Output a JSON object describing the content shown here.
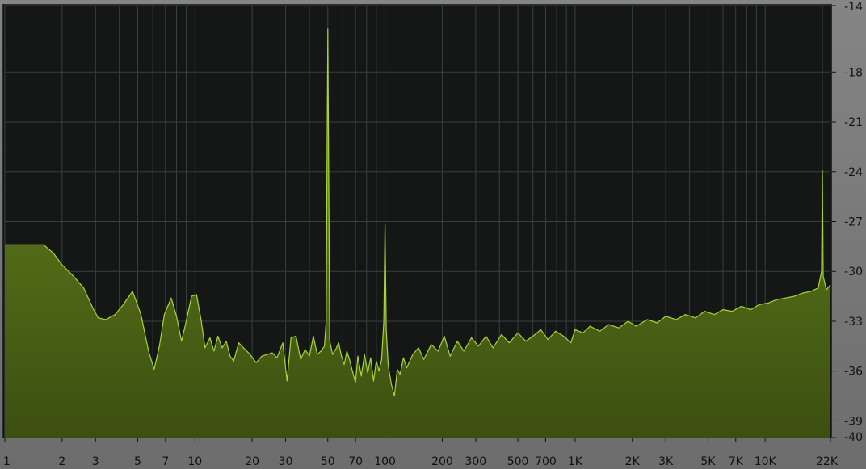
{
  "chart_data": {
    "type": "area",
    "title": "",
    "xlabel": "",
    "ylabel": "",
    "x_scale": "log",
    "xlim": [
      1,
      22050
    ],
    "ylim": [
      -40,
      -14
    ],
    "grid": true,
    "legend": "none",
    "colors": {
      "fill_top": "#6b8a1e",
      "fill_bottom": "#3c4f11",
      "line": "#a8d435",
      "background": "#151717",
      "grid": "#3a3f3f",
      "panel": "#7a7a7a",
      "label": "#111111"
    },
    "x_ticks": [
      {
        "value": 1,
        "label": "1"
      },
      {
        "value": 2,
        "label": "2"
      },
      {
        "value": 3,
        "label": "3"
      },
      {
        "value": 5,
        "label": "5"
      },
      {
        "value": 7,
        "label": "7"
      },
      {
        "value": 10,
        "label": "10"
      },
      {
        "value": 20,
        "label": "20"
      },
      {
        "value": 30,
        "label": "30"
      },
      {
        "value": 50,
        "label": "50"
      },
      {
        "value": 70,
        "label": "70"
      },
      {
        "value": 100,
        "label": "100"
      },
      {
        "value": 200,
        "label": "200"
      },
      {
        "value": 300,
        "label": "300"
      },
      {
        "value": 500,
        "label": "500"
      },
      {
        "value": 700,
        "label": "700"
      },
      {
        "value": 1000,
        "label": "1K"
      },
      {
        "value": 2000,
        "label": "2K"
      },
      {
        "value": 3000,
        "label": "3K"
      },
      {
        "value": 5000,
        "label": "5K"
      },
      {
        "value": 7000,
        "label": "7K"
      },
      {
        "value": 10000,
        "label": "10K"
      },
      {
        "value": 22050,
        "label": "22K"
      }
    ],
    "y_ticks": [
      {
        "value": -14,
        "label": "-14"
      },
      {
        "value": -18,
        "label": "-18"
      },
      {
        "value": -21,
        "label": "-21"
      },
      {
        "value": -24,
        "label": "-24"
      },
      {
        "value": -27,
        "label": "-27"
      },
      {
        "value": -30,
        "label": "-30"
      },
      {
        "value": -33,
        "label": "-33"
      },
      {
        "value": -36,
        "label": "-36"
      },
      {
        "value": -39,
        "label": "-39"
      },
      {
        "value": -40,
        "label": "-40"
      }
    ],
    "series": [
      {
        "points": [
          [
            1,
            -28.4
          ],
          [
            1.6,
            -28.4
          ],
          [
            1.8,
            -28.9
          ],
          [
            2.0,
            -29.6
          ],
          [
            2.3,
            -30.3
          ],
          [
            2.6,
            -31.0
          ],
          [
            2.9,
            -32.2
          ],
          [
            3.1,
            -32.8
          ],
          [
            3.4,
            -32.9
          ],
          [
            3.8,
            -32.6
          ],
          [
            4.2,
            -32.0
          ],
          [
            4.7,
            -31.2
          ],
          [
            5.2,
            -32.6
          ],
          [
            5.7,
            -34.8
          ],
          [
            6.1,
            -35.9
          ],
          [
            6.5,
            -34.5
          ],
          [
            6.9,
            -32.6
          ],
          [
            7.5,
            -31.6
          ],
          [
            8.0,
            -32.7
          ],
          [
            8.5,
            -34.2
          ],
          [
            9.0,
            -33.0
          ],
          [
            9.6,
            -31.5
          ],
          [
            10.2,
            -31.4
          ],
          [
            10.8,
            -33.0
          ],
          [
            11.3,
            -34.6
          ],
          [
            12.0,
            -34.0
          ],
          [
            12.6,
            -34.8
          ],
          [
            13.2,
            -33.9
          ],
          [
            13.9,
            -34.6
          ],
          [
            14.6,
            -34.2
          ],
          [
            15.3,
            -35.1
          ],
          [
            16.0,
            -35.4
          ],
          [
            17.0,
            -34.3
          ],
          [
            18.0,
            -34.6
          ],
          [
            19.5,
            -35.0
          ],
          [
            21.0,
            -35.5
          ],
          [
            22.5,
            -35.1
          ],
          [
            24.0,
            -35.0
          ],
          [
            25.5,
            -34.9
          ],
          [
            27.0,
            -35.2
          ],
          [
            29.0,
            -34.3
          ],
          [
            30.5,
            -36.6
          ],
          [
            32.0,
            -34.0
          ],
          [
            34.0,
            -33.9
          ],
          [
            36.0,
            -35.3
          ],
          [
            38.0,
            -34.7
          ],
          [
            40.0,
            -35.1
          ],
          [
            42.0,
            -33.9
          ],
          [
            44.0,
            -35.0
          ],
          [
            46.0,
            -34.8
          ],
          [
            48.0,
            -34.5
          ],
          [
            49.0,
            -33.0
          ],
          [
            49.6,
            -22.5
          ],
          [
            50.0,
            -15.4
          ],
          [
            50.4,
            -22.0
          ],
          [
            51.2,
            -34.2
          ],
          [
            53.0,
            -35.0
          ],
          [
            55.0,
            -34.7
          ],
          [
            57.0,
            -34.3
          ],
          [
            59.0,
            -35.1
          ],
          [
            61.0,
            -35.6
          ],
          [
            63.0,
            -34.8
          ],
          [
            65.0,
            -35.3
          ],
          [
            67.0,
            -35.9
          ],
          [
            70.0,
            -36.7
          ],
          [
            72.0,
            -35.1
          ],
          [
            75.0,
            -36.3
          ],
          [
            78.0,
            -35.0
          ],
          [
            81.0,
            -36.1
          ],
          [
            84.0,
            -35.2
          ],
          [
            87.0,
            -36.6
          ],
          [
            90.0,
            -35.4
          ],
          [
            93.0,
            -36.0
          ],
          [
            96.0,
            -35.3
          ],
          [
            98.5,
            -33.0
          ],
          [
            100.0,
            -27.1
          ],
          [
            101.5,
            -33.5
          ],
          [
            104.0,
            -35.7
          ],
          [
            108.0,
            -36.8
          ],
          [
            112.0,
            -37.5
          ],
          [
            116.0,
            -35.9
          ],
          [
            120.0,
            -36.2
          ],
          [
            125.0,
            -35.2
          ],
          [
            130.0,
            -35.8
          ],
          [
            140.0,
            -35.0
          ],
          [
            150.0,
            -34.6
          ],
          [
            160.0,
            -35.3
          ],
          [
            175.0,
            -34.4
          ],
          [
            190.0,
            -34.8
          ],
          [
            205.0,
            -33.9
          ],
          [
            220.0,
            -35.1
          ],
          [
            240.0,
            -34.2
          ],
          [
            260.0,
            -34.8
          ],
          [
            285.0,
            -34.0
          ],
          [
            310.0,
            -34.5
          ],
          [
            340.0,
            -33.9
          ],
          [
            370.0,
            -34.6
          ],
          [
            410.0,
            -33.8
          ],
          [
            450.0,
            -34.3
          ],
          [
            500.0,
            -33.7
          ],
          [
            550.0,
            -34.2
          ],
          [
            600.0,
            -33.9
          ],
          [
            660.0,
            -33.5
          ],
          [
            720.0,
            -34.1
          ],
          [
            790.0,
            -33.6
          ],
          [
            870.0,
            -33.9
          ],
          [
            950.0,
            -34.3
          ],
          [
            1000.0,
            -33.5
          ],
          [
            1100.0,
            -33.7
          ],
          [
            1200.0,
            -33.3
          ],
          [
            1350.0,
            -33.6
          ],
          [
            1500.0,
            -33.2
          ],
          [
            1700.0,
            -33.4
          ],
          [
            1900.0,
            -33.0
          ],
          [
            2100.0,
            -33.3
          ],
          [
            2400.0,
            -32.9
          ],
          [
            2700.0,
            -33.1
          ],
          [
            3000.0,
            -32.7
          ],
          [
            3400.0,
            -32.9
          ],
          [
            3800.0,
            -32.6
          ],
          [
            4300.0,
            -32.8
          ],
          [
            4800.0,
            -32.4
          ],
          [
            5400.0,
            -32.6
          ],
          [
            6000.0,
            -32.3
          ],
          [
            6700.0,
            -32.4
          ],
          [
            7500.0,
            -32.1
          ],
          [
            8400.0,
            -32.3
          ],
          [
            9300.0,
            -32.0
          ],
          [
            10400.0,
            -31.9
          ],
          [
            11500.0,
            -31.7
          ],
          [
            12800.0,
            -31.6
          ],
          [
            14200.0,
            -31.5
          ],
          [
            15800.0,
            -31.3
          ],
          [
            17400.0,
            -31.2
          ],
          [
            19000.0,
            -31.0
          ],
          [
            19800.0,
            -30.0
          ],
          [
            20000.0,
            -23.9
          ],
          [
            20200.0,
            -30.3
          ],
          [
            21000.0,
            -31.1
          ],
          [
            22050.0,
            -30.8
          ]
        ]
      }
    ]
  }
}
